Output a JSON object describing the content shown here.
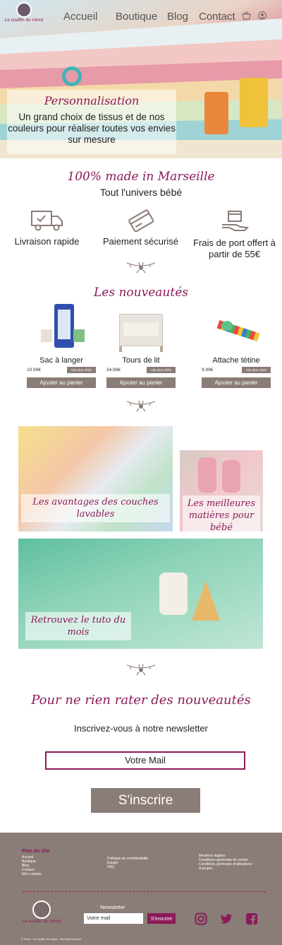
{
  "nav": {
    "logo_text": "Le couffin du minot",
    "links": [
      "Accueil",
      "Boutique",
      "Blog",
      "Contact"
    ],
    "cart_icon": "basket-icon",
    "account_icon": "user-icon"
  },
  "hero": {
    "title": "Personnalisation",
    "text": "Un grand choix de tissus et de nos couleurs pour réaliser toutes vos envies sur mesure"
  },
  "intro": {
    "made": "100% made in Marseille",
    "subtitle": "Tout l'univers bébé"
  },
  "features": [
    {
      "icon": "truck-icon",
      "label": "Livraison rapide"
    },
    {
      "icon": "credit-card-icon",
      "label": "Paiement sécurisé"
    },
    {
      "icon": "box-hand-icon",
      "label": "Frais de port offert à partir de 55€"
    }
  ],
  "new_section": {
    "title": "Les nouveautés",
    "products": [
      {
        "name": "Sac à langer",
        "price": "19.99€",
        "more": "Voir plus d'info",
        "button": "Ajouter au panier"
      },
      {
        "name": "Tours de lit",
        "price": "34.99€",
        "more": "Voir plus d'info",
        "button": "Ajouter au panier"
      },
      {
        "name": "Attache tétine",
        "price": "9.99€",
        "more": "Voir plus d'info",
        "button": "Ajouter au panier"
      }
    ]
  },
  "tiles": [
    {
      "label": "Les avantages des couches lavables"
    },
    {
      "label": "Les meilleures matières pour bébé"
    },
    {
      "label": "Retrouvez le tuto du mois"
    }
  ],
  "newsletter": {
    "title": "Pour ne rien rater des nouveautés",
    "subtitle": "Inscrivez-vous à notre newsletter",
    "placeholder": "Votre Mail",
    "button": "S'inscrire"
  },
  "footer": {
    "col1_title": "Plan du site",
    "col1": [
      "Accueil",
      "Boutique",
      "Blog",
      "Contact",
      "Mon compte"
    ],
    "col2": [
      "Politique de confidentialité",
      "Equipe",
      "FAQ"
    ],
    "col3": [
      "Mentions légales",
      "Conditions générales de ventes",
      "Conditions générales d'utilisations",
      "A propos"
    ],
    "logo_text": "Le couffin du minot",
    "newsletter_label": "Newsletter",
    "newsletter_placeholder": "Votre mail",
    "newsletter_button": "S'inscrire",
    "copyright": "© 2019 - Le Couffin du minot - Tout droit réservé"
  },
  "colors": {
    "brand": "#8a1b5a",
    "taupe": "#8a7c76"
  }
}
